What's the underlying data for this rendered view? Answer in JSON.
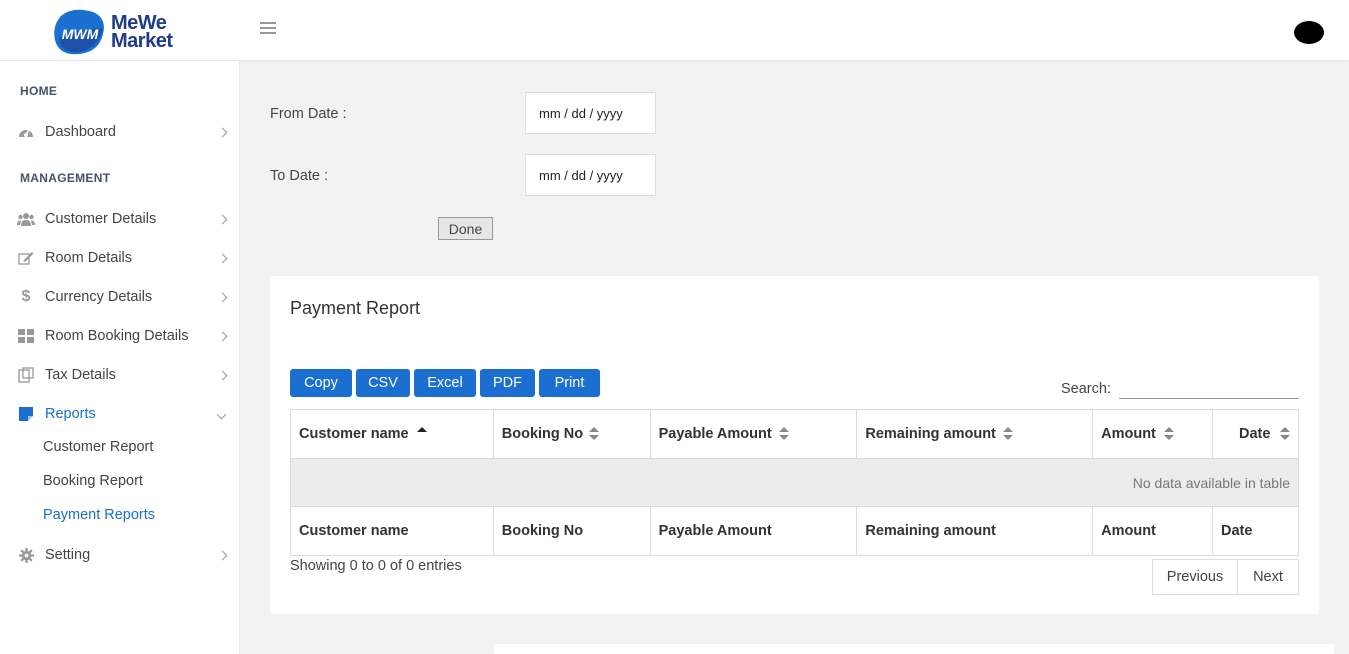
{
  "brand": {
    "line1": "MeWe",
    "line2": "Market",
    "mark": "MWM"
  },
  "sidebar": {
    "home_title": "HOME",
    "management_title": "MANAGEMENT",
    "items": [
      {
        "label": "Dashboard",
        "icon": "dashboard-icon"
      },
      {
        "label": "Customer Details",
        "icon": "users-icon"
      },
      {
        "label": "Room Details",
        "icon": "edit-icon"
      },
      {
        "label": "Currency Details",
        "icon": "dollar-icon"
      },
      {
        "label": "Room Booking Details",
        "icon": "grid-icon"
      },
      {
        "label": "Tax Details",
        "icon": "clipboard-icon"
      },
      {
        "label": "Reports",
        "icon": "report-icon"
      },
      {
        "label": "Setting",
        "icon": "gear-icon"
      }
    ],
    "sub_items": [
      "Customer Report",
      "Booking Report",
      "Payment Reports"
    ]
  },
  "form": {
    "from_label": "From Date :",
    "to_label": "To Date :",
    "date_placeholder": "mm / dd / yyyy",
    "done_label": "Done"
  },
  "report": {
    "title": "Payment Report",
    "buttons": [
      "Copy",
      "CSV",
      "Excel",
      "PDF",
      "Print"
    ],
    "search_label": "Search:",
    "columns": [
      "Customer name",
      "Booking No",
      "Payable Amount",
      "Remaining amount",
      "Amount",
      "Date"
    ],
    "empty_text": "No data available in table",
    "info": "Showing 0 to 0 of 0 entries",
    "prev_label": "Previous",
    "next_label": "Next"
  },
  "colors": {
    "accent": "#1a6fd0",
    "brand": "#1f3c88"
  }
}
